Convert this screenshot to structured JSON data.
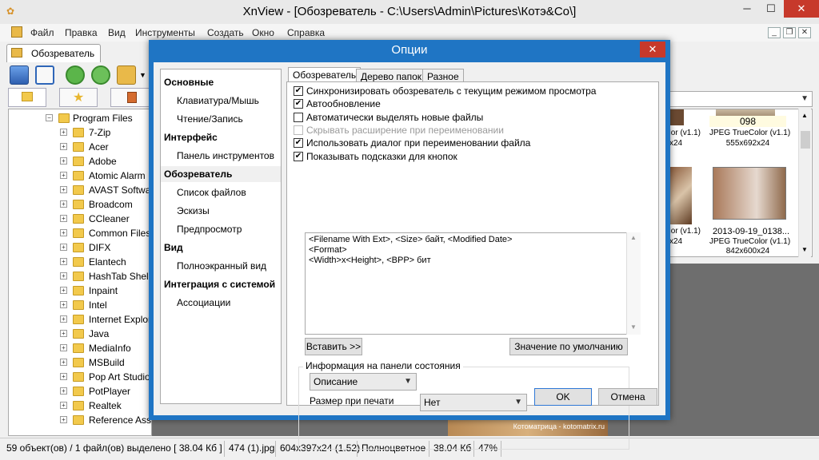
{
  "app": {
    "title": "XnView - [Обозреватель - C:\\Users\\Admin\\Pictures\\Котэ&Co\\]",
    "win_min": "─",
    "win_max": "☐",
    "win_close": "✕"
  },
  "menu": [
    "Файл",
    "Правка",
    "Вид",
    "Инструменты",
    "Создать",
    "Окно",
    "Справка"
  ],
  "main_tab": {
    "label": "Обозреватель"
  },
  "tree": {
    "root": "Program Files",
    "items": [
      "7-Zip",
      "Acer",
      "Adobe",
      "Atomic Alarm",
      "AVAST Softwa",
      "Broadcom",
      "CCleaner",
      "Common Files",
      "DIFX",
      "Elantech",
      "HashTab Shell",
      "Inpaint",
      "Intel",
      "Internet Explor",
      "Java",
      "MediaInfo",
      "MSBuild",
      "Pop Art Studio",
      "PotPlayer",
      "Realtek",
      "Reference Ass"
    ]
  },
  "thumbs": {
    "top": {
      "name": "098",
      "left_frag": "olor (v1.1)",
      "left_frag2": "x24",
      "info": "JPEG TrueColor (v1.1)",
      "dims": "555x692x24"
    },
    "bottom": {
      "left_frag": "olor (v1.1)",
      "left_frag2": "x24",
      "name": "2013-09-19_0138...",
      "info": "JPEG TrueColor (v1.1)",
      "dims": "842x600x24"
    }
  },
  "preview_caption": "Котоматрица - kotomatrix.ru",
  "status": {
    "selection": "59 объект(ов) / 1 файл(ов) выделено  [ 38.04 Кб ]",
    "filename": "474 (1).jpg",
    "dims": "604x397x24 (1.52)",
    "color": "Полноцветное",
    "size": "38.04 Кб",
    "zoom": "47%"
  },
  "dialog": {
    "title": "Опции",
    "close": "✕",
    "nav": [
      {
        "label": "Основные",
        "header": true
      },
      {
        "label": "Клавиатура/Мышь",
        "header": false
      },
      {
        "label": "Чтение/Запись",
        "header": false
      },
      {
        "label": "Интерфейс",
        "header": true
      },
      {
        "label": "Панель инструментов",
        "header": false
      },
      {
        "label": "Обозреватель",
        "header": true,
        "selected": true
      },
      {
        "label": "Список файлов",
        "header": false
      },
      {
        "label": "Эскизы",
        "header": false
      },
      {
        "label": "Предпросмотр",
        "header": false
      },
      {
        "label": "Вид",
        "header": true
      },
      {
        "label": "Полноэкранный вид",
        "header": false
      },
      {
        "label": "Интеграция с системой",
        "header": true
      },
      {
        "label": "Ассоциации",
        "header": false
      }
    ],
    "tabs": [
      "Обозреватель",
      "Дерево папок",
      "Разное"
    ],
    "checkboxes": [
      {
        "label": "Синхронизировать обозреватель с текущим режимом просмотра",
        "checked": true,
        "disabled": false
      },
      {
        "label": "Автообновление",
        "checked": true,
        "disabled": false
      },
      {
        "label": "Автоматически выделять новые файлы",
        "checked": false,
        "disabled": false
      },
      {
        "label": "Скрывать расширение при переименовании",
        "checked": false,
        "disabled": true
      },
      {
        "label": "Использовать диалог при переименовании файла",
        "checked": true,
        "disabled": false
      },
      {
        "label": "Показывать подсказки для кнопок",
        "checked": true,
        "disabled": false
      }
    ],
    "tooltip_format": [
      "<Filename With Ext>, <Size> байт, <Modified Date>",
      "<Format>",
      "<Width>x<Height>, <BPP> бит"
    ],
    "insert_button": "Вставить >>",
    "default_button": "Значение по умолчанию",
    "status_group": {
      "title": "Информация на панели состояния",
      "description_value": "Описание",
      "print_size_label": "Размер при печати",
      "print_size_value": "Нет"
    },
    "ok": "OK",
    "cancel": "Отмена"
  }
}
